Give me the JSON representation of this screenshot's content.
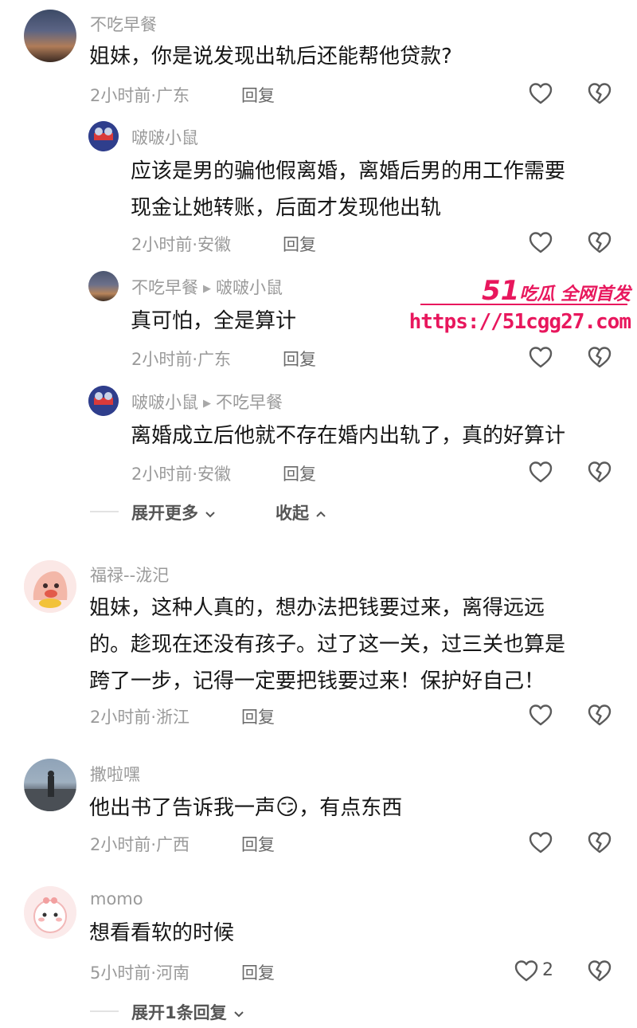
{
  "comments": [
    {
      "user": "不吃早餐",
      "text": "姐妹，你是说发现出轨后还能帮他贷款?",
      "time": "2小时前·广东",
      "reply_label": "回复",
      "replies": [
        {
          "user": "啵啵小鼠",
          "text_line1": "应该是男的骗他假离婚，离婚后男的用工作需要",
          "text_line2": "现金让她转账，后面才发现他出轨",
          "time": "2小时前·安徽",
          "reply_label": "回复"
        },
        {
          "user": "不吃早餐",
          "to": "啵啵小鼠",
          "text": "真可怕，全是算计",
          "time": "2小时前·广东",
          "reply_label": "回复"
        },
        {
          "user": "啵啵小鼠",
          "to": "不吃早餐",
          "text": "离婚成立后他就不存在婚内出轨了，真的好算计",
          "time": "2小时前·安徽",
          "reply_label": "回复"
        }
      ],
      "expand_more": "展开更多",
      "collapse": "收起"
    },
    {
      "user": "福禄--泷汜",
      "text_line1": "姐妹，这种人真的，想办法把钱要过来，离得远远",
      "text_line2": "的。趁现在还没有孩子。过了这一关，过三关也算是",
      "text_line3": "跨了一步，记得一定要把钱要过来！保护好自己！",
      "time": "2小时前·浙江",
      "reply_label": "回复"
    },
    {
      "user": "撒啦嘿",
      "text_before": "他出书了告诉我一声",
      "emoji": "😏",
      "text_after": "，有点东西",
      "time": "2小时前·广西",
      "reply_label": "回复"
    },
    {
      "user": "momo",
      "text": "想看看软的时候",
      "time": "5小时前·河南",
      "reply_label": "回复",
      "likes": "2",
      "expand_replies": "展开1条回复"
    }
  ],
  "watermark": {
    "line1_num": "51",
    "line1_text": "吃瓜 全网首发",
    "url": "https://51cgg27.com",
    "color": "#e8175d"
  },
  "icons": [
    "heart-outline-icon",
    "broken-heart-icon",
    "chevron-down-icon",
    "chevron-up-icon"
  ]
}
